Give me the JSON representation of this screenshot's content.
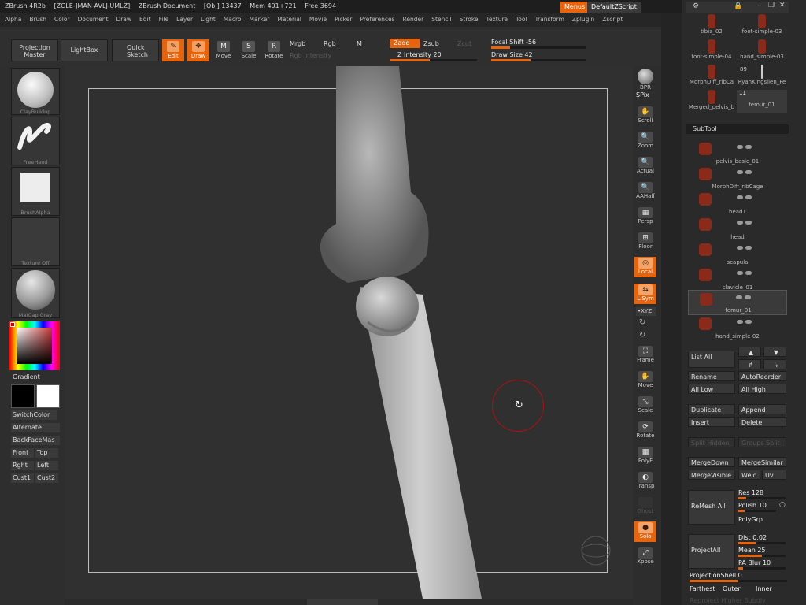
{
  "title": {
    "app": "ZBrush 4R2b",
    "tag": "[ZGLE-JMAN-AVLJ-UMLZ]",
    "doc": "ZBrush Document",
    "obj": "[Obj] 13437",
    "mem": "Mem 401+721",
    "free": "Free 3694",
    "menus_btn": "Menus",
    "script_btn": "DefaultZScript"
  },
  "menu": [
    "Alpha",
    "Brush",
    "Color",
    "Document",
    "Draw",
    "Edit",
    "File",
    "Layer",
    "Light",
    "Macro",
    "Marker",
    "Material",
    "Movie",
    "Picker",
    "Preferences",
    "Render",
    "Stencil",
    "Stroke",
    "Texture",
    "Tool",
    "Transform",
    "Zplugin",
    "Zscript"
  ],
  "toolbar": {
    "projection_master_1": "Projection",
    "projection_master_2": "Master",
    "lightbox": "LightBox",
    "quick_sketch_1": "Quick",
    "quick_sketch_2": "Sketch",
    "edit": "Edit",
    "draw": "Draw",
    "move": "Move",
    "scale": "Scale",
    "rotate": "Rotate",
    "mrgb": "Mrgb",
    "rgb": "Rgb",
    "m": "M",
    "rgb_intensity": "Rgb  Intensity",
    "zadd": "Zadd",
    "zsub": "Zsub",
    "zcut": "Zcut",
    "z_intensity": "Z  Intensity 20",
    "focal_shift": "Focal  Shift -56",
    "draw_size": "Draw  Size 42",
    "z_intensity_val": 20,
    "focal_shift_val": -56,
    "draw_size_val": 42
  },
  "left": {
    "brush": "ClayBuildup",
    "stroke": "FreeHand",
    "alpha": "BrushAlpha",
    "texture": "Texture  Off",
    "material": "MatCap  Gray",
    "gradient": "Gradient",
    "switch_color": "SwitchColor",
    "alternate": "Alternate",
    "backface": "BackFaceMas",
    "front": "Front",
    "top": "Top",
    "right": "Rght",
    "leftv": "Left",
    "cust1": "Cust1",
    "cust2": "Cust2"
  },
  "shelf": {
    "bpr": "BPR",
    "spix": "SPix",
    "scroll": "Scroll",
    "zoom": "Zoom",
    "actual": "Actual",
    "aahalf": "AAHalf",
    "persp": "Persp",
    "floor": "Floor",
    "local": "Local",
    "lsym": "L.Sym",
    "xyz": "•XYZ",
    "frame": "Frame",
    "move": "Move",
    "scale": "Scale",
    "rotate": "Rotate",
    "polyf": "PolyF",
    "transp": "Transp",
    "ghost": "Ghost",
    "solo": "Solo",
    "xpose": "Xpose"
  },
  "library": [
    {
      "label": "tibia_02"
    },
    {
      "label": "foot-simple-03"
    },
    {
      "label": "foot-simple-04"
    },
    {
      "label": "hand_simple-03"
    },
    {
      "label": "MorphDiff_ribCa"
    },
    {
      "label": "RyanKingslien_Fe"
    },
    {
      "label": "Merged_pelvis_b"
    },
    {
      "label": "femur_01"
    }
  ],
  "library_counts": {
    "c1": "89",
    "c2": "11"
  },
  "subtool": {
    "title": "SubTool",
    "items": [
      {
        "name": "pelvis_basic_01"
      },
      {
        "name": "MorphDiff_ribCage"
      },
      {
        "name": "head1"
      },
      {
        "name": "head"
      },
      {
        "name": "scapula"
      },
      {
        "name": "clavicle_01"
      },
      {
        "name": "femur_01"
      },
      {
        "name": "hand_simple-02"
      }
    ]
  },
  "subtool_buttons": {
    "list_all": "List  All",
    "rename": "Rename",
    "autoreorder": "AutoReorder",
    "all_low": "All  Low",
    "all_high": "All  High",
    "duplicate": "Duplicate",
    "append": "Append",
    "insert": "Insert",
    "delete": "Delete",
    "split_hidden": "Split  Hidden",
    "groups_split": "Groups  Split",
    "merge_down": "MergeDown",
    "merge_similar": "MergeSimilar",
    "merge_visible": "MergeVisible",
    "weld": "Weld",
    "uv": "Uv",
    "remesh_all": "ReMesh  All",
    "res": "Res 128",
    "polish": "Polish 10",
    "polygrp": "PolyGrp",
    "project_all": "ProjectAll",
    "dist": "Dist 0.02",
    "mean": "Mean 25",
    "pa_blur": "PA  Blur 10",
    "projection_shell": "ProjectionShell 0",
    "farthest": "Farthest",
    "outer": "Outer",
    "inner": "Inner",
    "reproject_higher": "Reproject  Higher  Subdiv"
  },
  "colors": {
    "accent": "#e8640c",
    "viewport": "#303030",
    "panel": "#2a2a2a"
  }
}
